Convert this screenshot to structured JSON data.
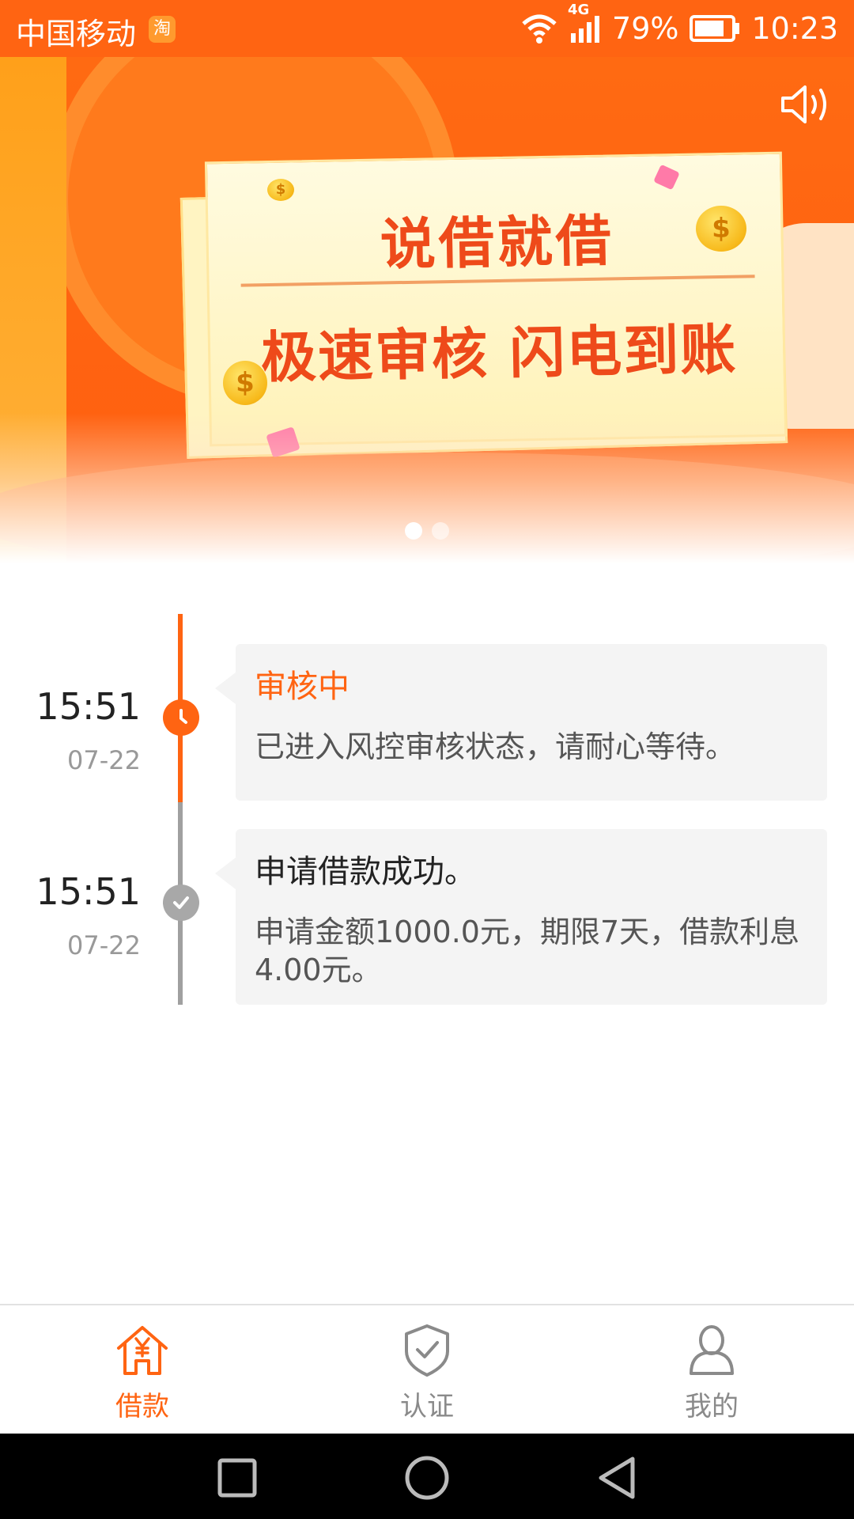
{
  "status_bar": {
    "carrier": "中国移动",
    "app_badge": "淘",
    "network": "4G",
    "battery": "79%",
    "time": "10:23"
  },
  "banner": {
    "title": "说借就借",
    "slogan": "极速审核 闪电到账",
    "page_count": 2,
    "active_page": 1
  },
  "timeline": {
    "entries": [
      {
        "time": "15:51",
        "date": "07-22",
        "status": "active",
        "title": "审核中",
        "description": "已进入风控审核状态，请耐心等待。"
      },
      {
        "time": "15:51",
        "date": "07-22",
        "status": "done",
        "title": "申请借款成功。",
        "description": "申请金额1000.0元，期限7天，借款利息4.00元。"
      }
    ]
  },
  "bottom_nav": {
    "items": [
      {
        "label": "借款",
        "icon": "house-yen-icon",
        "active": true
      },
      {
        "label": "认证",
        "icon": "shield-check-icon",
        "active": false
      },
      {
        "label": "我的",
        "icon": "user-icon",
        "active": false
      }
    ]
  },
  "colors": {
    "brand": "#ff6412",
    "timeline_done": "#a8a8a8",
    "card_bg": "#f4f4f4",
    "inactive_nav": "#8a8a8a"
  }
}
